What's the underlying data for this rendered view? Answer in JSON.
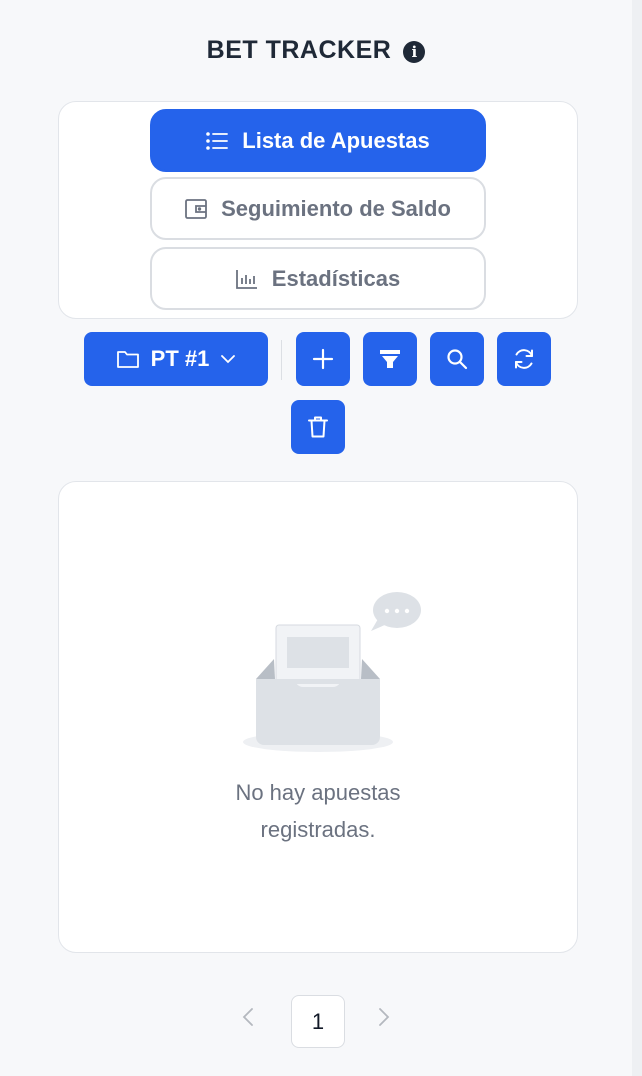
{
  "header": {
    "title": "BET TRACKER",
    "info_icon": "info-icon"
  },
  "nav": {
    "items": [
      {
        "label": "Lista de Apuestas",
        "icon": "list-icon",
        "active": true
      },
      {
        "label": "Seguimiento de Saldo",
        "icon": "wallet-icon",
        "active": false
      },
      {
        "label": "Estadísticas",
        "icon": "bar-chart-icon",
        "active": false
      }
    ]
  },
  "toolbar": {
    "folder_label": "PT #1",
    "buttons": [
      "add-icon",
      "filter-icon",
      "search-icon",
      "refresh-icon",
      "trash-icon"
    ]
  },
  "list": {
    "empty_line1": "No hay apuestas",
    "empty_line2": "registradas."
  },
  "pagination": {
    "current": "1",
    "prev": "<",
    "next": ">"
  },
  "colors": {
    "primary": "#2563eb",
    "background": "#f7f8fa",
    "text": "#1f2937",
    "muted": "#6b7280"
  }
}
